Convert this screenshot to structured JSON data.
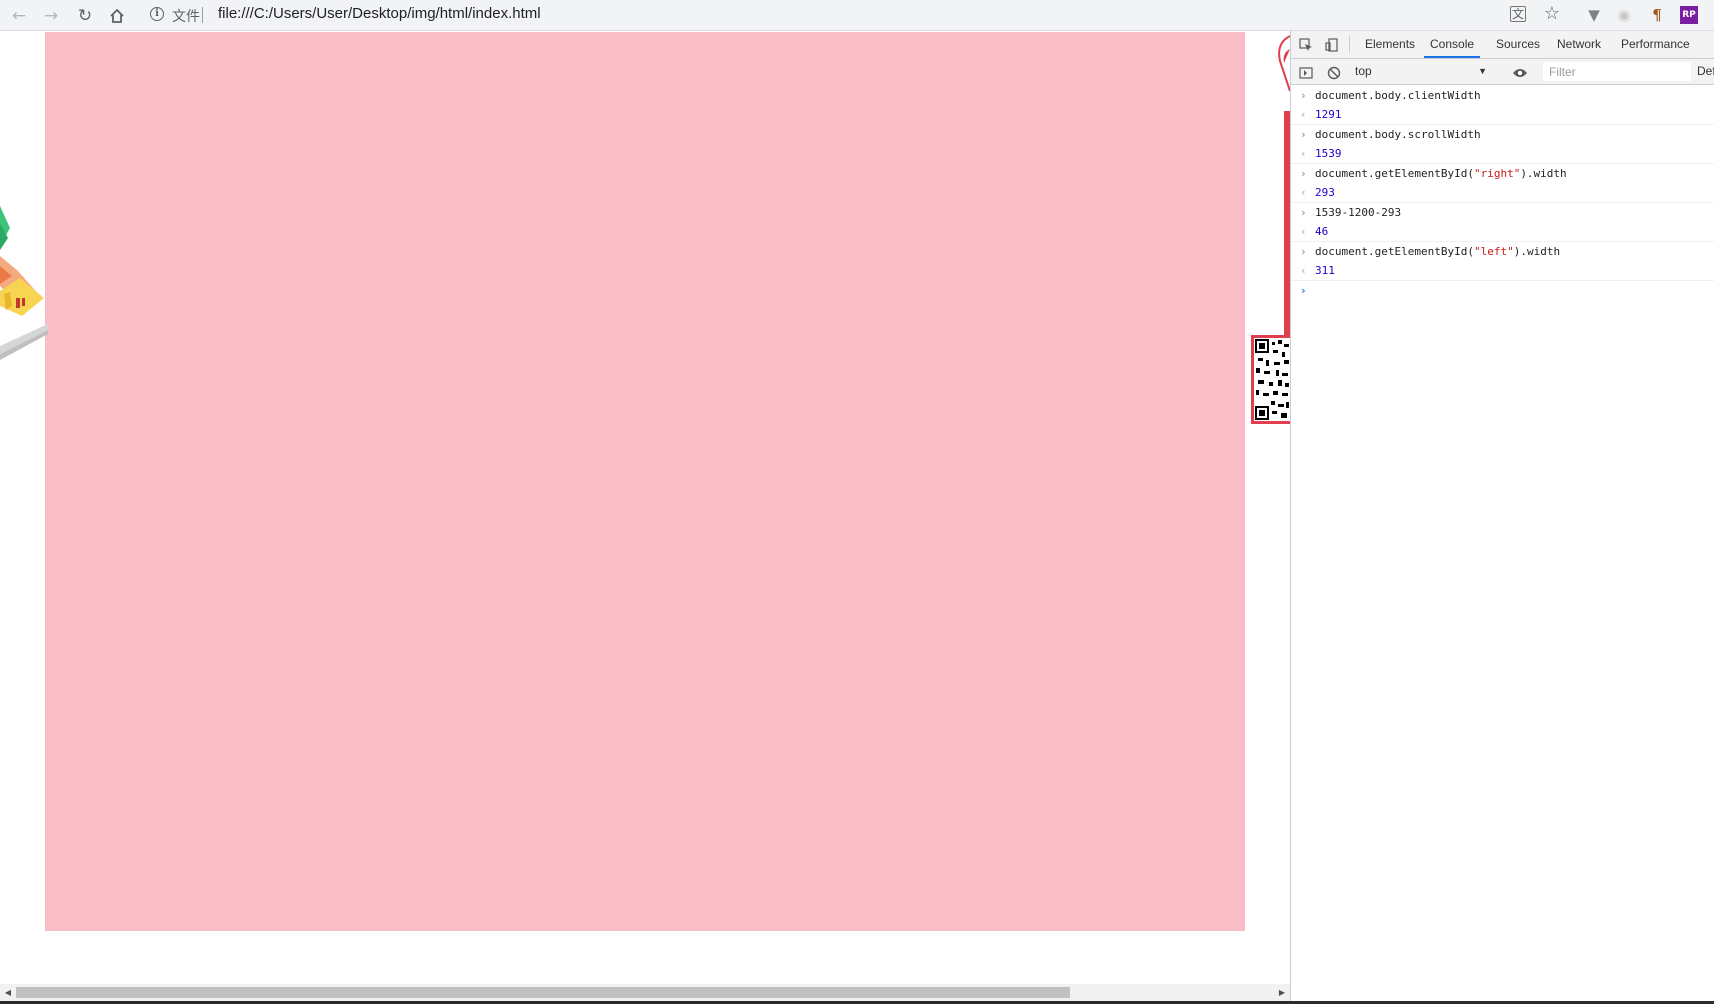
{
  "browser": {
    "scheme_label": "文件",
    "url": "file:///C:/Users/User/Desktop/img/html/index.html"
  },
  "page": {
    "box_color": "#f9bdc8",
    "accent_red": "#e0404e"
  },
  "devtools": {
    "tabs": [
      {
        "label": "Elements",
        "active": false
      },
      {
        "label": "Console",
        "active": true
      },
      {
        "label": "Sources",
        "active": false
      },
      {
        "label": "Network",
        "active": false
      },
      {
        "label": "Performance",
        "active": false
      }
    ],
    "context": "top",
    "filter_placeholder": "Filter",
    "levels_label": "Def",
    "console": [
      {
        "input": "document.body.clientWidth",
        "output": "1291"
      },
      {
        "input": "document.body.scrollWidth",
        "output": "1539"
      },
      {
        "input_pre": "document.getElementById(",
        "input_str": "\"right\"",
        "input_post": ").width",
        "output": "293"
      },
      {
        "input": "1539-1200-293",
        "output": "46"
      },
      {
        "input_pre": "document.getElementById(",
        "input_str": "\"left\"",
        "input_post": ").width",
        "output": "311"
      }
    ]
  },
  "icons": {
    "back": "arrow-left-icon",
    "forward": "arrow-right-icon",
    "reload": "reload-icon",
    "home": "home-icon",
    "info": "info-icon",
    "translate": "translate-icon",
    "bookmark": "star-icon"
  }
}
